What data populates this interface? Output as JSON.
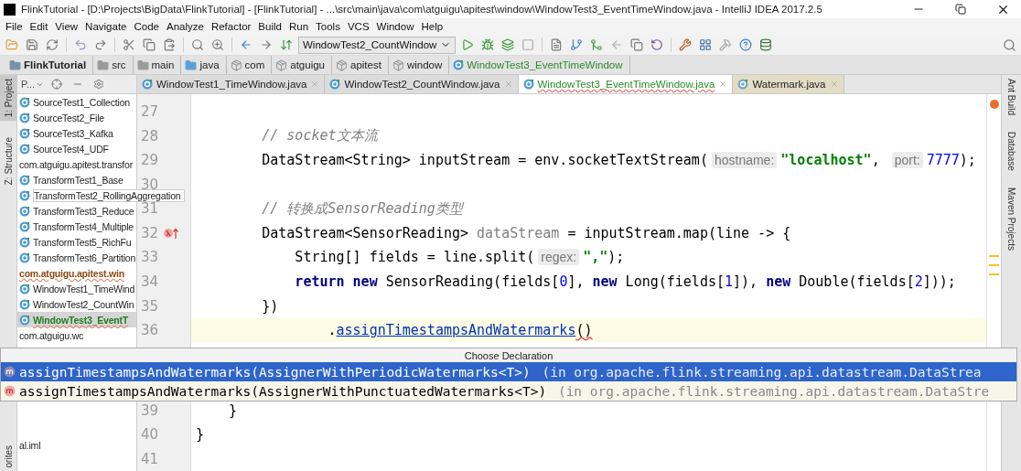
{
  "window": {
    "title": "FlinkTutorial - [D:\\Projects\\BigData\\FlinkTutorial] - [FlinkTutorial] - ...\\src\\main\\java\\com\\atguigu\\apitest\\window\\WindowTest3_EventTimeWindow.java - IntelliJ IDEA 2017.2.5"
  },
  "menu": [
    "File",
    "Edit",
    "View",
    "Navigate",
    "Code",
    "Analyze",
    "Refactor",
    "Build",
    "Run",
    "Tools",
    "VCS",
    "Window",
    "Help"
  ],
  "toolbar": {
    "run_config": "WindowTest2_CountWindow"
  },
  "breadcrumbs": [
    {
      "label": "FlinkTutorial",
      "kind": "project"
    },
    {
      "label": "src",
      "kind": "folder"
    },
    {
      "label": "main",
      "kind": "folder"
    },
    {
      "label": "java",
      "kind": "source-folder"
    },
    {
      "label": "com",
      "kind": "package"
    },
    {
      "label": "atguigu",
      "kind": "package"
    },
    {
      "label": "apitest",
      "kind": "package"
    },
    {
      "label": "window",
      "kind": "package"
    },
    {
      "label": "WindowTest3_EventTimeWindow",
      "kind": "class"
    }
  ],
  "left_strip": [
    "1: Project",
    "Z: Structure",
    "orites"
  ],
  "right_strip": [
    "Ant Build",
    "Database",
    "Maven Projects"
  ],
  "project_panel": {
    "view": "P...",
    "items": [
      {
        "label": "SourceTest1_Collection",
        "kind": "class",
        "selected": false,
        "error": false,
        "tooltip": false
      },
      {
        "label": "SourceTest2_File",
        "kind": "class",
        "selected": false,
        "error": false,
        "tooltip": false
      },
      {
        "label": "SourceTest3_Kafka",
        "kind": "class",
        "selected": false,
        "error": false,
        "tooltip": false
      },
      {
        "label": "SourceTest4_UDF",
        "kind": "class",
        "selected": false,
        "error": false,
        "tooltip": false
      },
      {
        "label": "com.atguigu.apitest.transfor",
        "kind": "package",
        "selected": false,
        "error": false,
        "tooltip": false
      },
      {
        "label": "TransformTest1_Base",
        "kind": "class",
        "selected": false,
        "error": false,
        "tooltip": false
      },
      {
        "label": "TransformTest2_RollingAggregation",
        "kind": "class",
        "selected": false,
        "error": false,
        "tooltip": true
      },
      {
        "label": "TransformTest3_Reduce",
        "kind": "class",
        "selected": false,
        "error": false,
        "tooltip": false
      },
      {
        "label": "TransformTest4_Multiple",
        "kind": "class",
        "selected": false,
        "error": false,
        "tooltip": false
      },
      {
        "label": "TransformTest5_RichFu",
        "kind": "class",
        "selected": false,
        "error": false,
        "tooltip": false
      },
      {
        "label": "TransformTest6_Partition",
        "kind": "class",
        "selected": false,
        "error": false,
        "tooltip": false
      },
      {
        "label": "com.atguigu.apitest.win",
        "kind": "package",
        "selected": false,
        "error": true,
        "tooltip": false
      },
      {
        "label": "WindowTest1_TimeWind",
        "kind": "class",
        "selected": false,
        "error": false,
        "tooltip": false
      },
      {
        "label": "WindowTest2_CountWin",
        "kind": "class",
        "selected": false,
        "error": false,
        "tooltip": false
      },
      {
        "label": "WindowTest3_EventT",
        "kind": "class",
        "selected": true,
        "error": true,
        "tooltip": false
      },
      {
        "label": "com.atguigu.wc",
        "kind": "package",
        "selected": false,
        "error": false,
        "tooltip": false
      }
    ],
    "items_below_popup": [
      {
        "label": "al.iml",
        "selected": false,
        "error": false,
        "tooltip": false
      }
    ]
  },
  "tabs": [
    {
      "label": "WindowTest1_TimeWindow.java",
      "kind": "source",
      "selected": false
    },
    {
      "label": "WindowTest2_CountWindow.java",
      "kind": "source",
      "selected": false
    },
    {
      "label": "WindowTest3_EventTimeWindow.java",
      "kind": "source",
      "selected": true
    },
    {
      "label": "Watermark.java",
      "kind": "library",
      "selected": false
    }
  ],
  "editor": {
    "lines_above_popup": [
      {
        "number": "27",
        "current": false,
        "marker": false
      },
      {
        "number": "28",
        "current": false,
        "marker": false,
        "segments": [
          {
            "text": "        // socket文本流",
            "kind": "comment"
          }
        ]
      },
      {
        "number": "29",
        "current": false,
        "marker": false,
        "segments": [
          {
            "text": "        DataStream<String> inputStream = env.socketTextStream(",
            "kind": "plain"
          },
          {
            "text": "hostname:",
            "kind": "hint"
          },
          {
            "text": "\"localhost\"",
            "kind": "string"
          },
          {
            "text": ", ",
            "kind": "plain"
          },
          {
            "text": "port:",
            "kind": "hint"
          },
          {
            "text": "7777",
            "kind": "number"
          },
          {
            "text": ");",
            "kind": "plain"
          }
        ]
      },
      {
        "number": "30",
        "current": false,
        "marker": false
      },
      {
        "number": "31",
        "current": false,
        "marker": false,
        "segments": [
          {
            "text": "        // 转换成SensorReading类型",
            "kind": "comment"
          }
        ]
      },
      {
        "number": "32",
        "current": false,
        "marker": true,
        "segments": [
          {
            "text": "        DataStream<SensorReading> ",
            "kind": "plain"
          },
          {
            "text": "dataStream",
            "kind": "unused"
          },
          {
            "text": " = inputStream.map(line -> {",
            "kind": "plain"
          }
        ]
      },
      {
        "number": "33",
        "current": false,
        "marker": false,
        "segments": [
          {
            "text": "            String[] fields = line.split(",
            "kind": "plain"
          },
          {
            "text": "regex:",
            "kind": "hint"
          },
          {
            "text": "\",\"",
            "kind": "string"
          },
          {
            "text": ");",
            "kind": "plain"
          }
        ]
      },
      {
        "number": "34",
        "current": false,
        "marker": false,
        "segments": [
          {
            "text": "            return new",
            "kind": "keyword"
          },
          {
            "text": " SensorReading(fields[",
            "kind": "plain"
          },
          {
            "text": "0",
            "kind": "number"
          },
          {
            "text": "], ",
            "kind": "plain"
          },
          {
            "text": "new",
            "kind": "keyword"
          },
          {
            "text": " Long(fields[",
            "kind": "plain"
          },
          {
            "text": "1",
            "kind": "number"
          },
          {
            "text": "]), ",
            "kind": "plain"
          },
          {
            "text": "new",
            "kind": "keyword"
          },
          {
            "text": " Double(fields[",
            "kind": "plain"
          },
          {
            "text": "2",
            "kind": "number"
          },
          {
            "text": "]));",
            "kind": "plain"
          }
        ]
      },
      {
        "number": "35",
        "current": false,
        "marker": false,
        "segments": [
          {
            "text": "        })",
            "kind": "plain"
          }
        ]
      },
      {
        "number": "36",
        "current": true,
        "marker": false,
        "segments": [
          {
            "text": "                .",
            "kind": "plain"
          },
          {
            "text": "assignTimestampsAndWatermarks",
            "kind": "link"
          },
          {
            "text": "()",
            "kind": "error"
          }
        ]
      }
    ],
    "lines_below_popup": [
      {
        "number": "39",
        "current": false,
        "marker": false,
        "segments": [
          {
            "text": "    }",
            "kind": "plain"
          }
        ]
      },
      {
        "number": "40",
        "current": false,
        "marker": false,
        "segments": [
          {
            "text": "}",
            "kind": "plain"
          }
        ]
      },
      {
        "number": "41",
        "current": false,
        "marker": false
      }
    ]
  },
  "popup": {
    "title": "Choose Declaration",
    "rows": [
      {
        "method": "assignTimestampsAndWatermarks(AssignerWithPeriodicWatermarks<T>)",
        "location": "(in org.apache.flink.streaming.api.datastream.DataStrea",
        "selected": true
      },
      {
        "method": "assignTimestampsAndWatermarks(AssignerWithPunctuatedWatermarks<T>)",
        "location": "(in org.apache.flink.streaming.api.datastream.DataStre",
        "selected": false
      }
    ]
  }
}
